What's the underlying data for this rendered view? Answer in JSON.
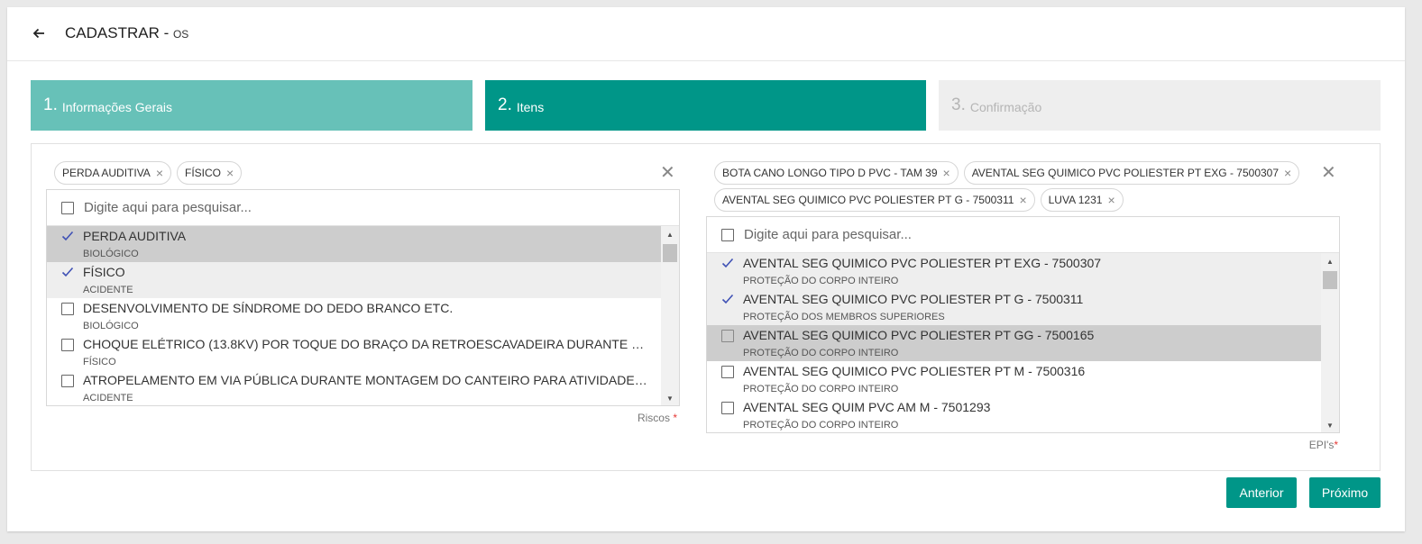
{
  "header": {
    "title": "CADASTRAR - ",
    "subtitle": "OS"
  },
  "steps": [
    {
      "num": "1.",
      "label": "Informações Gerais"
    },
    {
      "num": "2.",
      "label": "Itens"
    },
    {
      "num": "3.",
      "label": "Confirmação"
    }
  ],
  "riscos": {
    "chips": [
      {
        "label": "PERDA AUDITIVA"
      },
      {
        "label": "FÍSICO"
      }
    ],
    "clear_glyph": "✕",
    "search_placeholder": "Digite aqui para pesquisar...",
    "items": [
      {
        "name": "PERDA AUDITIVA",
        "category": "BIOLÓGICO",
        "checked": true,
        "highlight": "dark"
      },
      {
        "name": "FÍSICO",
        "category": "ACIDENTE",
        "checked": true,
        "highlight": "light"
      },
      {
        "name": "DESENVOLVIMENTO DE SÍNDROME DO DEDO BRANCO ETC.",
        "category": "BIOLÓGICO",
        "checked": false,
        "highlight": "none"
      },
      {
        "name": "CHOQUE ELÉTRICO (13.8KV) POR TOQUE DO BRAÇO DA RETROESCAVADEIRA DURANTE …",
        "category": "FÍSICO",
        "checked": false,
        "highlight": "none"
      },
      {
        "name": "ATROPELAMENTO EM VIA PÚBLICA DURANTE MONTAGEM DO CANTEIRO PARA ATIVIDADE…",
        "category": "ACIDENTE",
        "checked": false,
        "highlight": "none"
      }
    ],
    "field_label": "Riscos",
    "required_mark": "*"
  },
  "epis": {
    "chips": [
      {
        "label": "BOTA CANO LONGO TIPO D PVC - TAM 39"
      },
      {
        "label": "AVENTAL SEG QUIMICO PVC POLIESTER PT EXG - 7500307"
      },
      {
        "label": "AVENTAL SEG QUIMICO PVC POLIESTER PT G - 7500311"
      },
      {
        "label": "LUVA 1231"
      }
    ],
    "clear_glyph": "✕",
    "search_placeholder": "Digite aqui para pesquisar...",
    "items": [
      {
        "name": "AVENTAL SEG QUIMICO PVC POLIESTER PT EXG - 7500307",
        "category": "PROTEÇÃO DO CORPO INTEIRO",
        "checked": true,
        "highlight": "light"
      },
      {
        "name": "AVENTAL SEG QUIMICO PVC POLIESTER PT G - 7500311",
        "category": "PROTEÇÃO DOS MEMBROS SUPERIORES",
        "checked": true,
        "highlight": "light"
      },
      {
        "name": "AVENTAL SEG QUIMICO PVC POLIESTER PT GG - 7500165",
        "category": "PROTEÇÃO DO CORPO INTEIRO",
        "checked": false,
        "highlight": "dark"
      },
      {
        "name": "AVENTAL SEG QUIMICO PVC POLIESTER PT M - 7500316",
        "category": "PROTEÇÃO DO CORPO INTEIRO",
        "checked": false,
        "highlight": "none"
      },
      {
        "name": "AVENTAL SEG QUIM PVC AM M - 7501293",
        "category": "PROTEÇÃO DO CORPO INTEIRO",
        "checked": false,
        "highlight": "none"
      }
    ],
    "field_label": "EPI's",
    "required_mark": "*"
  },
  "actions": {
    "prev_label": "Anterior",
    "next_label": "Próximo"
  },
  "colors": {
    "accent": "#009688",
    "accent_light": "#67c1b8",
    "inactive": "#eeeeee",
    "check": "#3f51b5",
    "required": "#e53935"
  }
}
